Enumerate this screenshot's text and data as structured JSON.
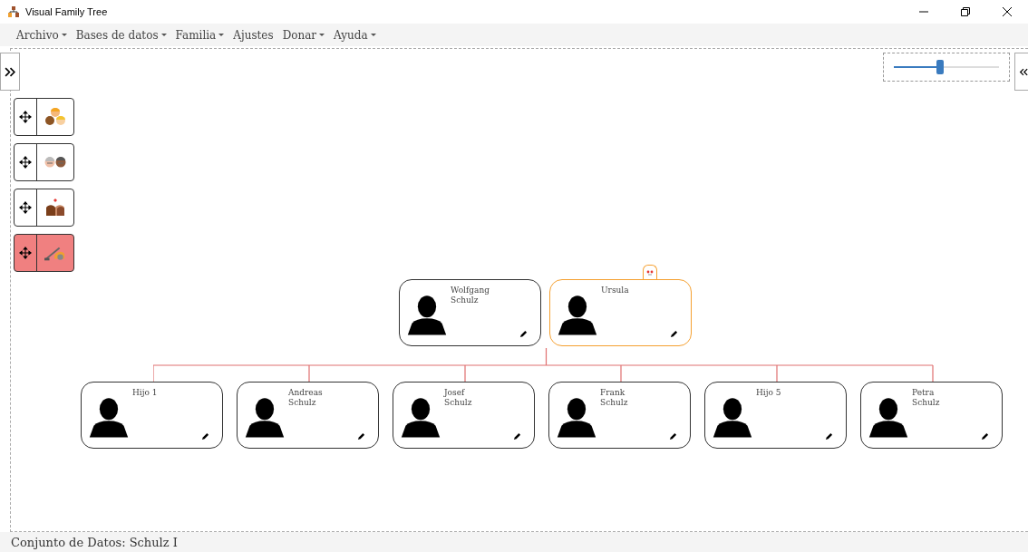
{
  "window": {
    "title": "Visual Family Tree"
  },
  "menu": [
    {
      "label": "Archivo",
      "dropdown": true
    },
    {
      "label": "Bases de datos",
      "dropdown": true
    },
    {
      "label": "Familia",
      "dropdown": true
    },
    {
      "label": "Ajustes",
      "dropdown": false
    },
    {
      "label": "Donar",
      "dropdown": true
    },
    {
      "label": "Ayuda",
      "dropdown": true
    }
  ],
  "zoom": {
    "level": 0.44
  },
  "tools": [
    {
      "kind": "family",
      "selected": false
    },
    {
      "kind": "grandparents",
      "selected": false
    },
    {
      "kind": "couple",
      "selected": false
    },
    {
      "kind": "vacuum",
      "selected": true
    }
  ],
  "parents": [
    {
      "lines": [
        "Wolfgang",
        "Schulz"
      ],
      "selected": false,
      "badge": false
    },
    {
      "lines": [
        "Ursula"
      ],
      "selected": true,
      "badge": true
    }
  ],
  "children": [
    {
      "lines": [
        "Hijo 1"
      ]
    },
    {
      "lines": [
        "Andreas",
        "Schulz"
      ]
    },
    {
      "lines": [
        "Josef",
        "Schulz"
      ]
    },
    {
      "lines": [
        "Frank",
        "Schulz"
      ]
    },
    {
      "lines": [
        "Hijo 5"
      ]
    },
    {
      "lines": [
        "Petra",
        "Schulz"
      ]
    }
  ],
  "status_bar": "Conjunto de Datos: Schulz I"
}
